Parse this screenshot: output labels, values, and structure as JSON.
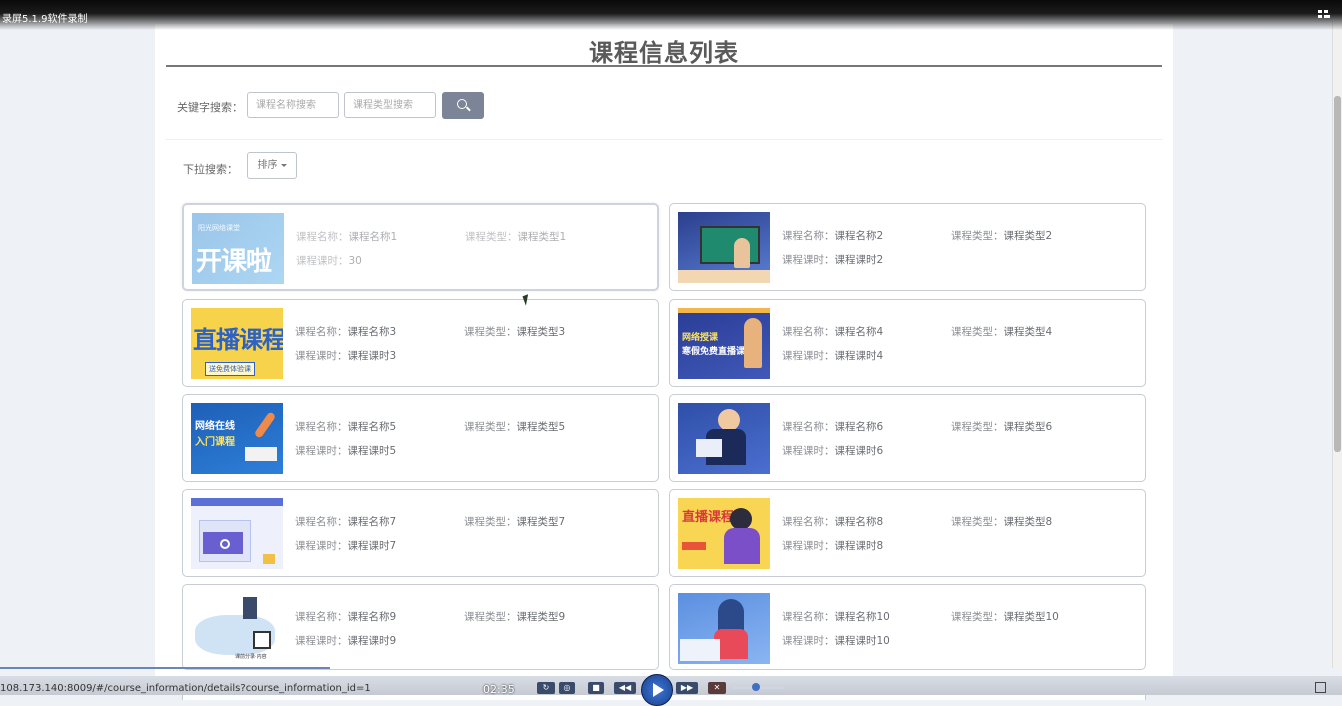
{
  "recorder": {
    "title": "录屏5.1.9软件录制",
    "time": "02:35",
    "url": "108.173.140:8009/#/course_information/details?course_information_id=1"
  },
  "page": {
    "title": "课程信息列表"
  },
  "search": {
    "keyword_label": "关键字搜索：",
    "name_placeholder": "课程名称搜索",
    "type_placeholder": "课程类型搜索",
    "dropdown_label": "下拉搜索：",
    "sort_label": "排序"
  },
  "labels": {
    "name": "课程名称：",
    "type": "课程类型：",
    "hours": "课程课时："
  },
  "courses": [
    {
      "name": "课程名称1",
      "type": "课程类型1",
      "hours": "30",
      "thumb_text": "开课啦",
      "thumb_sub": "阳光网络课堂"
    },
    {
      "name": "课程名称2",
      "type": "课程类型2",
      "hours": "课程课时2",
      "thumb_text": "",
      "thumb_sub": ""
    },
    {
      "name": "课程名称3",
      "type": "课程类型3",
      "hours": "课程课时3",
      "thumb_text": "直播课程",
      "thumb_sub": "送免费体验课"
    },
    {
      "name": "课程名称4",
      "type": "课程类型4",
      "hours": "课程课时4",
      "thumb_text": "网络授课",
      "thumb_sub": "寒假免费直播课"
    },
    {
      "name": "课程名称5",
      "type": "课程类型5",
      "hours": "课程课时5",
      "thumb_text": "网络在线",
      "thumb_sub": "入门课程"
    },
    {
      "name": "课程名称6",
      "type": "课程类型6",
      "hours": "课程课时6",
      "thumb_text": "",
      "thumb_sub": ""
    },
    {
      "name": "课程名称7",
      "type": "课程类型7",
      "hours": "课程课时7",
      "thumb_text": "",
      "thumb_sub": ""
    },
    {
      "name": "课程名称8",
      "type": "课程类型8",
      "hours": "课程课时8",
      "thumb_text": "直播课程",
      "thumb_sub": ""
    },
    {
      "name": "课程名称9",
      "type": "课程类型9",
      "hours": "课程课时9",
      "thumb_text": "",
      "thumb_sub": "课前分录·内容"
    },
    {
      "name": "课程名称10",
      "type": "课程类型10",
      "hours": "课程课时10",
      "thumb_text": "",
      "thumb_sub": ""
    }
  ],
  "colors": {
    "title": "#5a5a5a",
    "search_button": "#7c8597",
    "card_border": "#c8ccd3",
    "active_border": "#a9b0c8"
  }
}
